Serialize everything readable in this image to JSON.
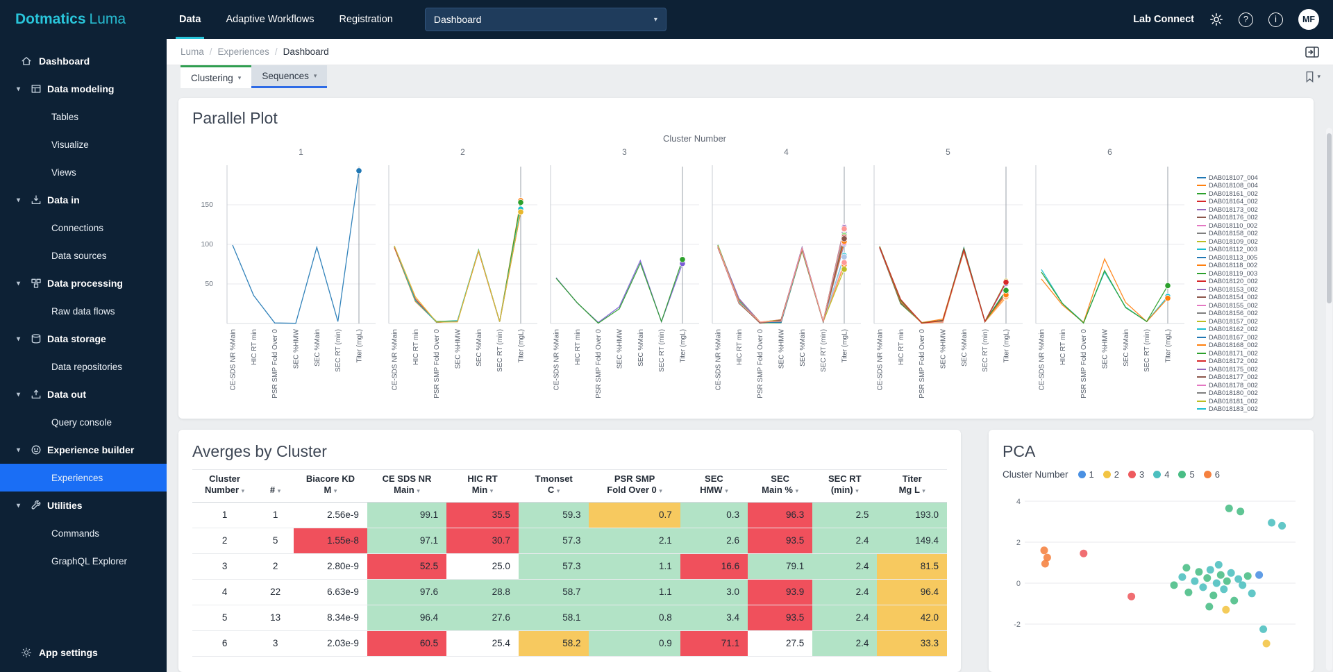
{
  "navbar": {
    "logo": {
      "bold": "Dotmatics",
      "light": "Luma"
    },
    "items": [
      {
        "label": "Data",
        "active": true
      },
      {
        "label": "Adaptive Workflows",
        "active": false
      },
      {
        "label": "Registration",
        "active": false
      }
    ],
    "dropdown": {
      "value": "Dashboard"
    },
    "lab_connect": "Lab Connect",
    "avatar": "MF",
    "accent": "#29c5da"
  },
  "sidebar": {
    "items": [
      {
        "label": "Dashboard",
        "type": "root",
        "icon": "home"
      },
      {
        "label": "Data modeling",
        "type": "section",
        "icon": "table"
      },
      {
        "label": "Tables",
        "type": "child"
      },
      {
        "label": "Visualize",
        "type": "child"
      },
      {
        "label": "Views",
        "type": "child"
      },
      {
        "label": "Data in",
        "type": "section",
        "icon": "data-in"
      },
      {
        "label": "Connections",
        "type": "child"
      },
      {
        "label": "Data sources",
        "type": "child"
      },
      {
        "label": "Data processing",
        "type": "section",
        "icon": "processing"
      },
      {
        "label": "Raw data flows",
        "type": "child"
      },
      {
        "label": "Data storage",
        "type": "section",
        "icon": "database"
      },
      {
        "label": "Data repositories",
        "type": "child"
      },
      {
        "label": "Data out",
        "type": "section",
        "icon": "data-out"
      },
      {
        "label": "Query console",
        "type": "child"
      },
      {
        "label": "Experience builder",
        "type": "section",
        "icon": "experience"
      },
      {
        "label": "Experiences",
        "type": "child",
        "selected": true
      },
      {
        "label": "Utilities",
        "type": "section",
        "icon": "utilities"
      },
      {
        "label": "Commands",
        "type": "child"
      },
      {
        "label": "GraphQL Explorer",
        "type": "child"
      }
    ],
    "footer": {
      "label": "App settings",
      "icon": "gear"
    },
    "selected_color": "#1a6ef5"
  },
  "breadcrumb": {
    "items": [
      "Luma",
      "Experiences",
      "Dashboard"
    ]
  },
  "tabs": {
    "items": [
      {
        "label": "Clustering",
        "state": "active",
        "accent": "#2f9e50"
      },
      {
        "label": "Sequences",
        "state": "selected",
        "accent": "#2e6be6"
      }
    ]
  },
  "chart_data": [
    {
      "type": "line",
      "variant": "parallel-coordinates-faceted",
      "title": "Parallel Plot",
      "facet_title": "Cluster Number",
      "axes": [
        "CE-SDS NR %Main",
        "HIC RT min",
        "PSR SMP Fold Over 0",
        "SEC %HMW",
        "SEC %Main",
        "SEC RT (min)",
        "Titer (mgL)"
      ],
      "yticks": [
        50,
        100,
        150
      ],
      "ylim": [
        0,
        200
      ],
      "grid": true,
      "legend_position": "right",
      "clusters": [
        {
          "number": 1,
          "count": 1,
          "means": [
            99.1,
            35.5,
            0.7,
            0.3,
            96.3,
            2.5,
            193.0
          ],
          "spread": [
            0,
            0,
            0,
            0,
            0,
            0,
            0
          ],
          "colors": [
            "#1f77b4"
          ]
        },
        {
          "number": 2,
          "count": 5,
          "means": [
            97.1,
            30.7,
            2.1,
            2.6,
            93.5,
            2.4,
            149.4
          ],
          "spread": [
            1.5,
            3,
            1.2,
            1.5,
            2,
            0.3,
            10
          ],
          "colors": [
            "#ff7f0e",
            "#2ca02c",
            "#d62728",
            "#17becf",
            "#e8b72c"
          ]
        },
        {
          "number": 3,
          "count": 2,
          "means": [
            52.5,
            25.0,
            1.1,
            16.6,
            79.1,
            2.4,
            81.5
          ],
          "spread": [
            7,
            3,
            0.8,
            7,
            10,
            0.2,
            16
          ],
          "colors": [
            "#7b5cd6",
            "#2ca02c"
          ]
        },
        {
          "number": 4,
          "count": 22,
          "means": [
            97.6,
            28.8,
            1.1,
            3.0,
            93.9,
            2.4,
            96.4
          ],
          "spread": [
            1.8,
            3.5,
            0.9,
            2,
            2.5,
            0.3,
            30
          ],
          "colors": [
            "#d62728",
            "#e377c2",
            "#17becf",
            "#2ca02c",
            "#ff7f0e",
            "#9467bd",
            "#1f77b4",
            "#bcbd22",
            "#8c564b",
            "#ff9896",
            "#98df8a",
            "#aec7e8"
          ]
        },
        {
          "number": 5,
          "count": 13,
          "means": [
            96.4,
            27.6,
            0.8,
            3.4,
            93.5,
            2.4,
            42.0
          ],
          "spread": [
            2,
            3,
            0.7,
            2.2,
            2.5,
            0.3,
            13
          ],
          "colors": [
            "#ff7f0e",
            "#2ca02c",
            "#d62728",
            "#9467bd",
            "#17becf",
            "#bcbd22",
            "#e377c2",
            "#1f77b4",
            "#8c564b",
            "#ffbb78"
          ]
        },
        {
          "number": 6,
          "count": 3,
          "means": [
            60.5,
            25.4,
            0.9,
            71.1,
            27.5,
            2.4,
            33.3
          ],
          "spread": [
            9,
            2.5,
            0.7,
            14,
            9,
            0.2,
            15
          ],
          "colors": [
            "#17becf",
            "#ff7f0e",
            "#2ca02c"
          ]
        }
      ],
      "legend_series": [
        "DAB018107_004",
        "DAB018108_004",
        "DAB018161_002",
        "DAB018164_002",
        "DAB018173_002",
        "DAB018176_002",
        "DAB018110_002",
        "DAB018158_002",
        "DAB018109_002",
        "DAB018112_003",
        "DAB018113_005",
        "DAB018118_002",
        "DAB018119_003",
        "DAB018120_002",
        "DAB018153_002",
        "DAB018154_002",
        "DAB018155_002",
        "DAB018156_002",
        "DAB018157_002",
        "DAB018162_002",
        "DAB018167_002",
        "DAB018168_002",
        "DAB018171_002",
        "DAB018172_002",
        "DAB018175_002",
        "DAB018177_002",
        "DAB018178_002",
        "DAB018180_002",
        "DAB018181_002",
        "DAB018183_002"
      ]
    },
    {
      "type": "table",
      "title": "Averges by Cluster",
      "cell_colors": {
        "g": "#b2e3c6",
        "r": "#f0505c",
        "o": "#f7c95f"
      },
      "columns": [
        {
          "line1": "Cluster",
          "line2": "Number"
        },
        {
          "line1": "",
          "line2": "#"
        },
        {
          "line1": "Biacore KD",
          "line2": "M"
        },
        {
          "line1": "CE SDS NR",
          "line2": "Main"
        },
        {
          "line1": "HIC RT",
          "line2": "Min"
        },
        {
          "line1": "Tmonset",
          "line2": "C"
        },
        {
          "line1": "PSR SMP",
          "line2": "Fold Over 0"
        },
        {
          "line1": "SEC",
          "line2": "HMW"
        },
        {
          "line1": "SEC",
          "line2": "Main %"
        },
        {
          "line1": "SEC RT",
          "line2": "(min)"
        },
        {
          "line1": "Titer",
          "line2": "Mg L"
        }
      ],
      "rows": [
        [
          {
            "v": "1"
          },
          {
            "v": "1"
          },
          {
            "v": "2.56e-9"
          },
          {
            "v": "99.1",
            "c": "g"
          },
          {
            "v": "35.5",
            "c": "r"
          },
          {
            "v": "59.3",
            "c": "g"
          },
          {
            "v": "0.7",
            "c": "o"
          },
          {
            "v": "0.3",
            "c": "g"
          },
          {
            "v": "96.3",
            "c": "r"
          },
          {
            "v": "2.5",
            "c": "g"
          },
          {
            "v": "193.0",
            "c": "g"
          }
        ],
        [
          {
            "v": "2"
          },
          {
            "v": "5"
          },
          {
            "v": "1.55e-8",
            "c": "r"
          },
          {
            "v": "97.1",
            "c": "g"
          },
          {
            "v": "30.7",
            "c": "r"
          },
          {
            "v": "57.3",
            "c": "g"
          },
          {
            "v": "2.1",
            "c": "g"
          },
          {
            "v": "2.6",
            "c": "g"
          },
          {
            "v": "93.5",
            "c": "r"
          },
          {
            "v": "2.4",
            "c": "g"
          },
          {
            "v": "149.4",
            "c": "g"
          }
        ],
        [
          {
            "v": "3"
          },
          {
            "v": "2"
          },
          {
            "v": "2.80e-9"
          },
          {
            "v": "52.5",
            "c": "r"
          },
          {
            "v": "25.0"
          },
          {
            "v": "57.3",
            "c": "g"
          },
          {
            "v": "1.1",
            "c": "g"
          },
          {
            "v": "16.6",
            "c": "r"
          },
          {
            "v": "79.1",
            "c": "g"
          },
          {
            "v": "2.4",
            "c": "g"
          },
          {
            "v": "81.5",
            "c": "o"
          }
        ],
        [
          {
            "v": "4"
          },
          {
            "v": "22"
          },
          {
            "v": "6.63e-9"
          },
          {
            "v": "97.6",
            "c": "g"
          },
          {
            "v": "28.8",
            "c": "g"
          },
          {
            "v": "58.7",
            "c": "g"
          },
          {
            "v": "1.1",
            "c": "g"
          },
          {
            "v": "3.0",
            "c": "g"
          },
          {
            "v": "93.9",
            "c": "r"
          },
          {
            "v": "2.4",
            "c": "g"
          },
          {
            "v": "96.4",
            "c": "o"
          }
        ],
        [
          {
            "v": "5"
          },
          {
            "v": "13"
          },
          {
            "v": "8.34e-9"
          },
          {
            "v": "96.4",
            "c": "g"
          },
          {
            "v": "27.6",
            "c": "g"
          },
          {
            "v": "58.1",
            "c": "g"
          },
          {
            "v": "0.8",
            "c": "g"
          },
          {
            "v": "3.4",
            "c": "g"
          },
          {
            "v": "93.5",
            "c": "r"
          },
          {
            "v": "2.4",
            "c": "g"
          },
          {
            "v": "42.0",
            "c": "o"
          }
        ],
        [
          {
            "v": "6"
          },
          {
            "v": "3"
          },
          {
            "v": "2.03e-9"
          },
          {
            "v": "60.5",
            "c": "r"
          },
          {
            "v": "25.4"
          },
          {
            "v": "58.2",
            "c": "o"
          },
          {
            "v": "0.9",
            "c": "g"
          },
          {
            "v": "71.1",
            "c": "r"
          },
          {
            "v": "27.5"
          },
          {
            "v": "2.4",
            "c": "g"
          },
          {
            "v": "33.3",
            "c": "o"
          }
        ]
      ]
    },
    {
      "type": "scatter",
      "title": "PCA",
      "legend_title": "Cluster Number",
      "legend_position": "top",
      "yticks": [
        4,
        2,
        0,
        -2
      ],
      "grid": true,
      "cluster_colors": {
        "1": "#4a90e2",
        "2": "#f2c443",
        "3": "#ee5a5e",
        "4": "#4cbfbf",
        "5": "#49bd85",
        "6": "#f5813f"
      },
      "clusters": [
        {
          "id": "1",
          "color": "#4a90e2"
        },
        {
          "id": "2",
          "color": "#f2c443"
        },
        {
          "id": "3",
          "color": "#ee5a5e"
        },
        {
          "id": "4",
          "color": "#4cbfbf"
        },
        {
          "id": "5",
          "color": "#49bd85"
        },
        {
          "id": "6",
          "color": "#f5813f"
        }
      ],
      "points": [
        [
          -5.9,
          1.6,
          6
        ],
        [
          -5.75,
          1.25,
          6
        ],
        [
          -5.85,
          0.95,
          6
        ],
        [
          -4.0,
          1.45,
          3
        ],
        [
          -1.7,
          -0.65,
          3
        ],
        [
          4.45,
          0.4,
          1
        ],
        [
          2.85,
          -1.3,
          2
        ],
        [
          4.8,
          -2.95,
          2
        ],
        [
          5.05,
          2.95,
          4
        ],
        [
          5.55,
          2.8,
          4
        ],
        [
          3.0,
          3.65,
          5
        ],
        [
          3.55,
          3.5,
          5
        ],
        [
          0.35,
          -0.1,
          5
        ],
        [
          0.75,
          0.3,
          4
        ],
        [
          1.05,
          -0.45,
          5
        ],
        [
          1.35,
          0.1,
          4
        ],
        [
          1.55,
          0.55,
          5
        ],
        [
          1.75,
          -0.2,
          4
        ],
        [
          1.95,
          0.25,
          5
        ],
        [
          2.1,
          0.65,
          4
        ],
        [
          2.25,
          -0.6,
          5
        ],
        [
          2.4,
          0.0,
          4
        ],
        [
          2.6,
          0.4,
          5
        ],
        [
          2.75,
          -0.3,
          4
        ],
        [
          2.9,
          0.1,
          5
        ],
        [
          3.1,
          0.5,
          4
        ],
        [
          3.25,
          -0.85,
          5
        ],
        [
          3.45,
          0.2,
          4
        ],
        [
          2.05,
          -1.15,
          5
        ],
        [
          2.5,
          0.9,
          4
        ],
        [
          0.95,
          0.75,
          5
        ],
        [
          3.65,
          -0.1,
          4
        ],
        [
          3.9,
          0.35,
          5
        ],
        [
          4.1,
          -0.5,
          4
        ],
        [
          4.65,
          -2.25,
          4
        ]
      ]
    }
  ]
}
